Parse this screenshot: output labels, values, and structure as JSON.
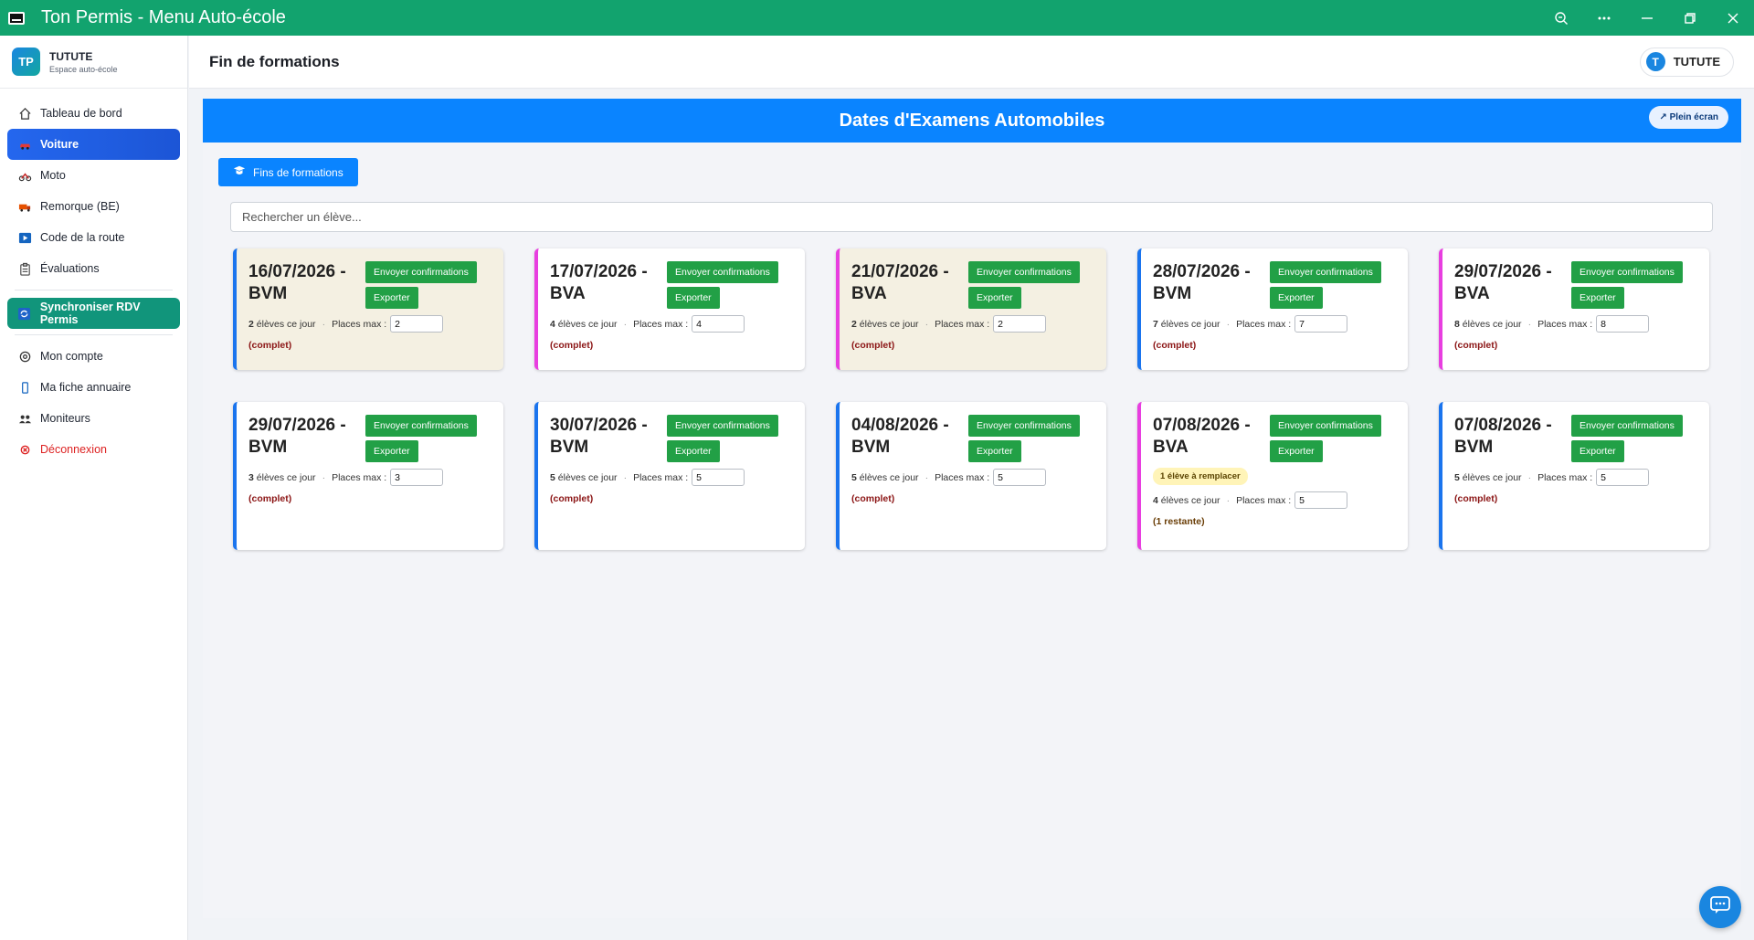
{
  "window": {
    "title": "Ton Permis - Menu Auto-école"
  },
  "brand": {
    "logo": "TP",
    "name": "TUTUTE",
    "subtitle": "Espace auto-école"
  },
  "sidebar": {
    "items": [
      {
        "label": "Tableau de bord",
        "icon": "home-icon"
      },
      {
        "label": "Voiture",
        "icon": "car-icon",
        "active": true
      },
      {
        "label": "Moto",
        "icon": "motorcycle-icon"
      },
      {
        "label": "Remorque (BE)",
        "icon": "truck-icon"
      },
      {
        "label": "Code de la route",
        "icon": "play-icon"
      },
      {
        "label": "Évaluations",
        "icon": "clipboard-icon"
      }
    ],
    "sync_label": "Synchroniser RDV Permis",
    "bottom_items": [
      {
        "label": "Mon compte",
        "icon": "gear-icon"
      },
      {
        "label": "Ma fiche annuaire",
        "icon": "phone-icon"
      },
      {
        "label": "Moniteurs",
        "icon": "users-icon"
      },
      {
        "label": "Déconnexion",
        "icon": "logout-icon"
      }
    ]
  },
  "header": {
    "title": "Fin de formations",
    "user_initial": "T",
    "user_name": "TUTUTE"
  },
  "main": {
    "banner_title": "Dates d'Examens Automobiles",
    "fullscreen_label": "↗ Plein écran",
    "fins_button_label": "Fins de formations",
    "search_placeholder": "Rechercher un élève...",
    "send_label": "Envoyer confirmations",
    "export_label": "Exporter",
    "students_suffix": "élèves ce jour",
    "places_label": "Places max :"
  },
  "cards": [
    {
      "title": "16/07/2026 - BVM",
      "type": "BVM",
      "highlight": true,
      "students": "2",
      "places": "2",
      "status": "(complet)"
    },
    {
      "title": "17/07/2026 - BVA",
      "type": "BVA",
      "highlight": false,
      "students": "4",
      "places": "4",
      "status": "(complet)"
    },
    {
      "title": "21/07/2026 - BVA",
      "type": "BVA",
      "highlight": true,
      "students": "2",
      "places": "2",
      "status": "(complet)"
    },
    {
      "title": "28/07/2026 - BVM",
      "type": "BVM",
      "highlight": false,
      "students": "7",
      "places": "7",
      "status": "(complet)"
    },
    {
      "title": "29/07/2026 - BVA",
      "type": "BVA",
      "highlight": false,
      "students": "8",
      "places": "8",
      "status": "(complet)"
    },
    {
      "title": "29/07/2026 - BVM",
      "type": "BVM",
      "highlight": false,
      "students": "3",
      "places": "3",
      "status": "(complet)"
    },
    {
      "title": "30/07/2026 - BVM",
      "type": "BVM",
      "highlight": false,
      "students": "5",
      "places": "5",
      "status": "(complet)"
    },
    {
      "title": "04/08/2026 - BVM",
      "type": "BVM",
      "highlight": false,
      "students": "5",
      "places": "5",
      "status": "(complet)"
    },
    {
      "title": "07/08/2026 - BVA",
      "type": "BVA",
      "highlight": false,
      "students": "4",
      "places": "5",
      "status": "(1 restante)",
      "badge": "1 élève à remplacer"
    },
    {
      "title": "07/08/2026 - BVM",
      "type": "BVM",
      "highlight": false,
      "students": "5",
      "places": "5",
      "status": "(complet)"
    }
  ],
  "colors": {
    "titlebar": "#12a36e",
    "accent": "#0a84ff",
    "bvm_border": "#1a74ee",
    "bva_border": "#e83ee0",
    "button_green": "#22a046",
    "sync": "#11957b"
  }
}
